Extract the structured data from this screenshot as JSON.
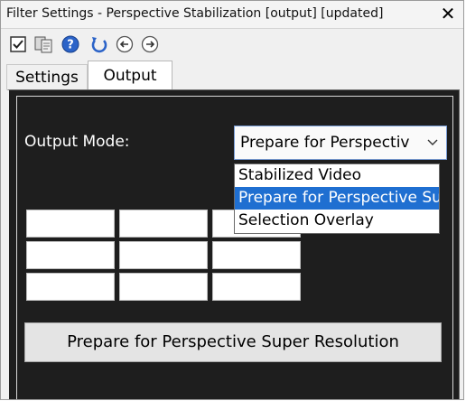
{
  "window": {
    "title": "Filter Settings - Perspective Stabilization [output] [updated]",
    "close_symbol": "✕"
  },
  "toolbar": {
    "icons": [
      "checkbox-icon",
      "copy-settings-icon",
      "help-icon",
      "reset-icon",
      "previous-icon",
      "next-icon"
    ]
  },
  "tabs": [
    {
      "label": "Settings",
      "active": false
    },
    {
      "label": "Output",
      "active": true
    }
  ],
  "output": {
    "mode_label": "Output Mode:",
    "selected_value": "Prepare for Perspectiv",
    "options": [
      {
        "label": "Stabilized Video",
        "selected": false
      },
      {
        "label": "Prepare for Perspective Su",
        "selected": true
      },
      {
        "label": "Selection Overlay",
        "selected": false
      }
    ],
    "action_button": "Prepare for Perspective Super Resolution"
  },
  "colors": {
    "panel_bg": "#1e1e1e",
    "highlight": "#1f6fd1",
    "window_bg": "#f0f0f0"
  }
}
